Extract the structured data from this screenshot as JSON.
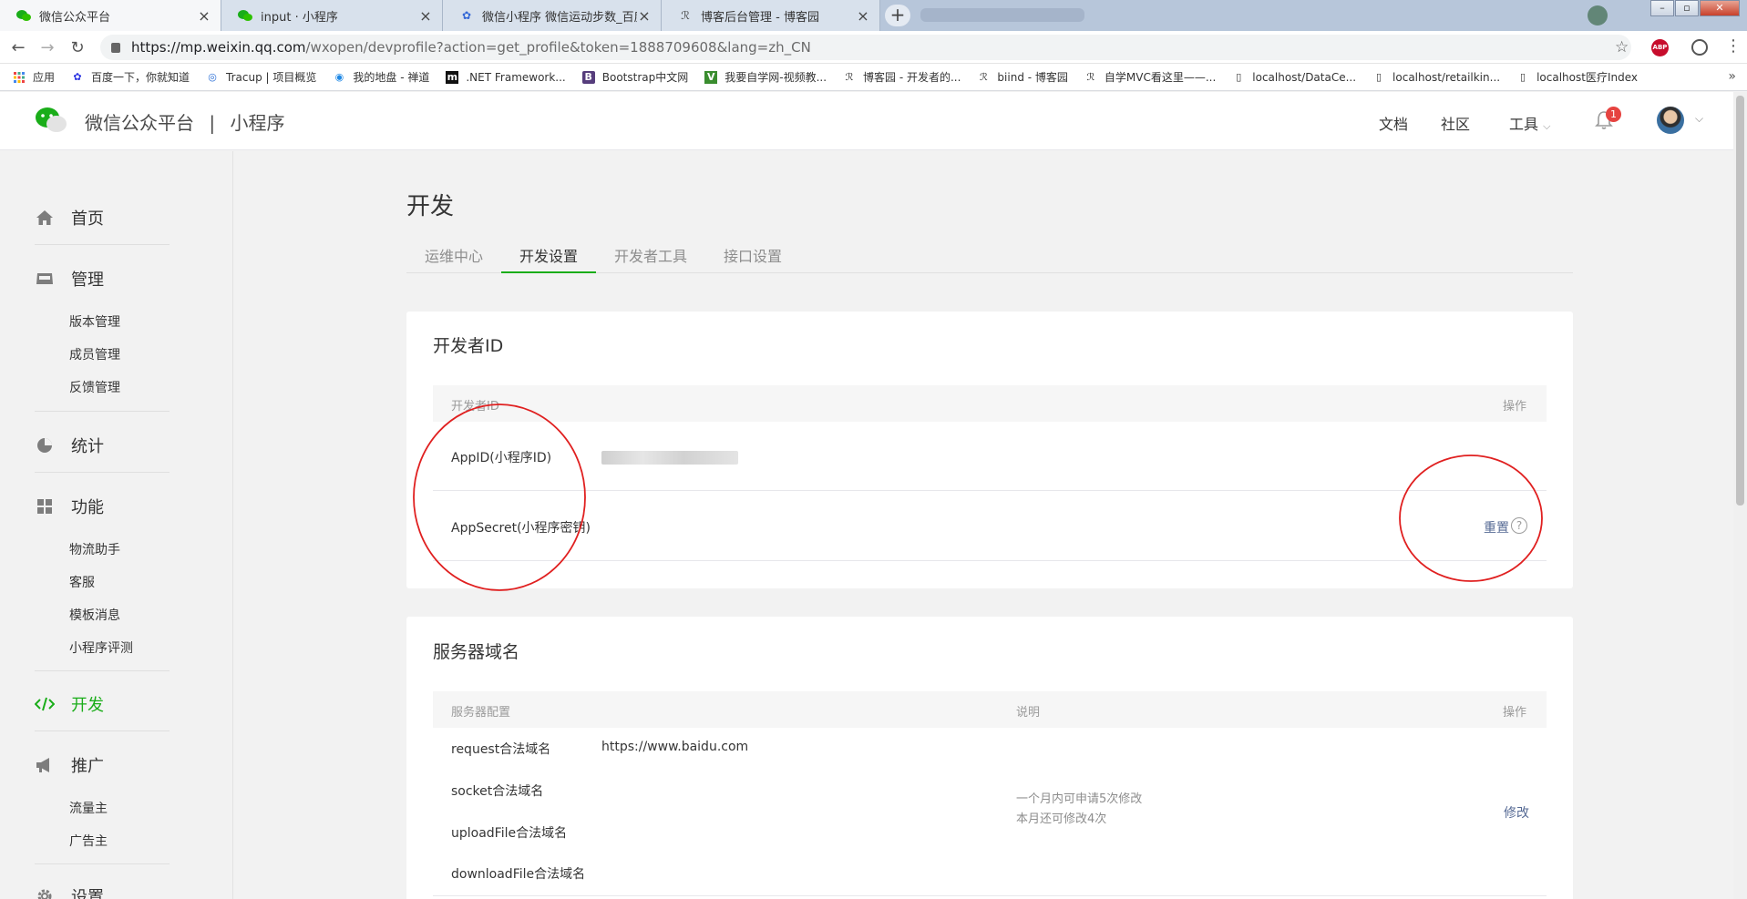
{
  "browser": {
    "tabs": [
      {
        "title": "微信公众平台",
        "icon": "wechat-icon"
      },
      {
        "title": "input · 小程序",
        "icon": "wechat-icon"
      },
      {
        "title": "微信小程序 微信运动步数_百度搜",
        "icon": "baidu-paw-icon"
      },
      {
        "title": "博客后台管理 - 博客园",
        "icon": "cnblogs-icon"
      }
    ],
    "url_host": "https://mp.weixin.qq.com",
    "url_path": "/wxopen/devprofile?action=get_profile&token=1888709608&lang=zh_CN",
    "abp_label": "ABP",
    "bookmarks": [
      {
        "label": "应用",
        "icon": "apps-grid-icon"
      },
      {
        "label": "百度一下，你就知道",
        "icon": "baidu-paw-icon"
      },
      {
        "label": "Tracup | 项目概览",
        "icon": "tracup-icon"
      },
      {
        "label": "我的地盘 - 禅道",
        "icon": "zentao-icon"
      },
      {
        "label": ".NET Framework...",
        "icon": "m-logo-icon"
      },
      {
        "label": "Bootstrap中文网",
        "icon": "bootstrap-icon"
      },
      {
        "label": "我要自学网-视频教...",
        "icon": "zixue-icon"
      },
      {
        "label": "博客园 - 开发者的...",
        "icon": "cnblogs-icon"
      },
      {
        "label": "biind - 博客园",
        "icon": "cnblogs-icon"
      },
      {
        "label": "自学MVC看这里——...",
        "icon": "cnblogs-icon"
      },
      {
        "label": "localhost/DataCe...",
        "icon": "page-icon"
      },
      {
        "label": "localhost/retailkin...",
        "icon": "page-icon"
      },
      {
        "label": "localhost医疗Index",
        "icon": "page-icon"
      }
    ]
  },
  "header": {
    "brand": "微信公众平台",
    "separator": "|",
    "product": "小程序",
    "nav": {
      "docs": "文档",
      "community": "社区",
      "tools": "工具"
    },
    "notification_count": "1"
  },
  "sidebar": {
    "groups": [
      {
        "label": "首页",
        "icon": "home-icon"
      },
      {
        "label": "管理",
        "icon": "inbox-icon",
        "items": [
          "版本管理",
          "成员管理",
          "反馈管理"
        ]
      },
      {
        "label": "统计",
        "icon": "pie-chart-icon"
      },
      {
        "label": "功能",
        "icon": "grid-icon",
        "items": [
          "物流助手",
          "客服",
          "模板消息",
          "小程序评测"
        ]
      },
      {
        "label": "开发",
        "icon": "code-icon"
      },
      {
        "label": "推广",
        "icon": "megaphone-icon",
        "items": [
          "流量主",
          "广告主"
        ]
      },
      {
        "label": "设置",
        "icon": "gear-icon"
      }
    ]
  },
  "main": {
    "title": "开发",
    "tabs": [
      "运维中心",
      "开发设置",
      "开发者工具",
      "接口设置"
    ],
    "active_tab": "开发设置",
    "dev_id": {
      "title": "开发者ID",
      "col_id": "开发者ID",
      "col_op": "操作",
      "appid_label": "AppID(小程序ID)",
      "appsecret_label": "AppSecret(小程序密钥)",
      "reset": "重置",
      "help": "?"
    },
    "server": {
      "title": "服务器域名",
      "col_config": "服务器配置",
      "col_desc": "说明",
      "col_op": "操作",
      "request": "request合法域名",
      "request_value": "https://www.baidu.com",
      "socket": "socket合法域名",
      "upload": "uploadFile合法域名",
      "download": "downloadFile合法域名",
      "desc1": "一个月内可申请5次修改",
      "desc2": "本月还可修改4次",
      "modify": "修改"
    }
  },
  "colors": {
    "accent": "#1aad19",
    "link": "#576b95",
    "annotation": "#e02020",
    "badge": "#e64340"
  }
}
